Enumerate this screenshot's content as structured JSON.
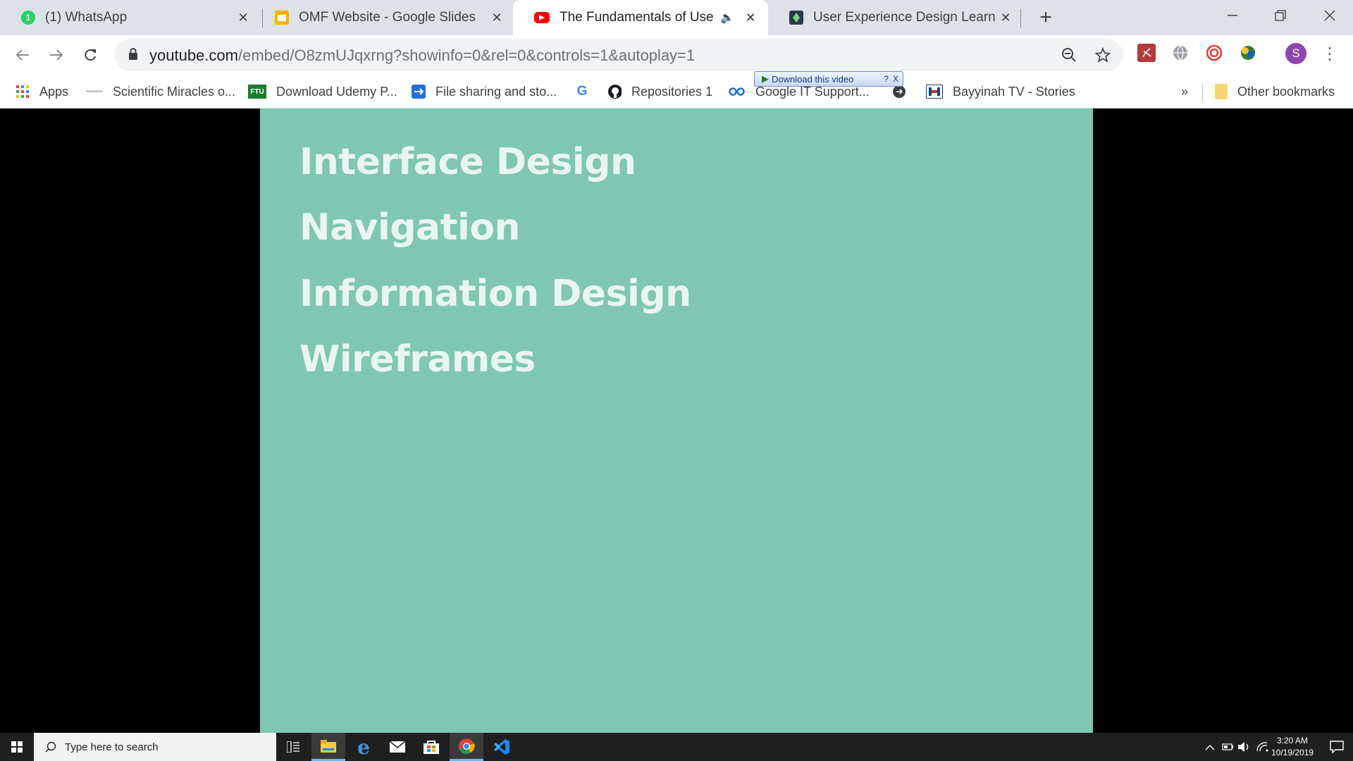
{
  "tabs": [
    {
      "title": "(1) WhatsApp",
      "icon": "whatsapp-icon",
      "badge": "1"
    },
    {
      "title": "OMF Website - Google Slides",
      "icon": "google-slides-icon"
    },
    {
      "title": "The Fundamentals of User Ex",
      "icon": "youtube-icon",
      "active": true,
      "audio_icon": "speaker-icon"
    },
    {
      "title": "User Experience Design Learning",
      "icon": "dark-app-icon"
    }
  ],
  "toolbar": {
    "url_main": "youtube.com",
    "url_path": "/embed/O8zmUJqxrng?showinfo=0&rel=0&controls=1&autoplay=1"
  },
  "profile": {
    "initial": "S",
    "color": "#8e44ad"
  },
  "bookmarks": {
    "apps": "Apps",
    "items": [
      "Scientific Miracles o...",
      "Download Udemy P...",
      "File sharing and sto...",
      "",
      "Repositories 1",
      "Google IT Support...",
      "Bayyinah TV - Stories"
    ],
    "overflow": "»",
    "other": "Other bookmarks",
    "ftu_label": "FTU",
    "google_label": "G"
  },
  "download_popup": {
    "label": "Download this video",
    "help": "?",
    "close": "X"
  },
  "slide": {
    "background": "#7fc7b2",
    "items": [
      "Interface Design",
      "Navigation",
      "Information Design",
      "Wireframes"
    ]
  },
  "taskbar": {
    "search_placeholder": "Type here to search",
    "time": "3:20 AM",
    "date": "10/19/2019"
  }
}
